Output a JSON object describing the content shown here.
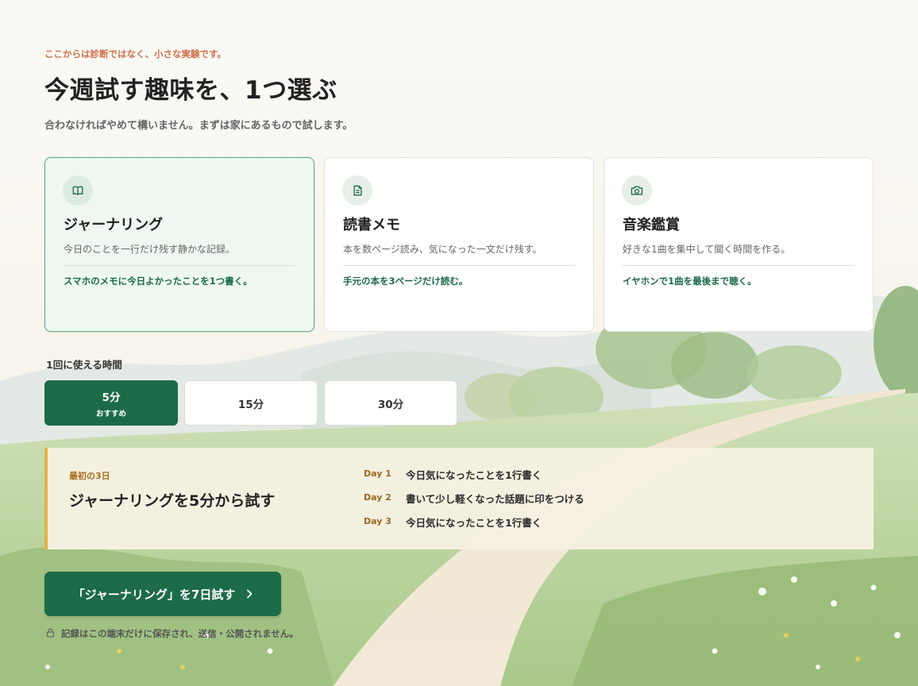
{
  "header": {
    "eyebrow": "ここからは診断ではなく、小さな実験です。",
    "title": "今週試す趣味を、1つ選ぶ",
    "subtitle": "合わなければやめて構いません。まずは家にあるもので試します。"
  },
  "hobbies": [
    {
      "icon": "book-icon",
      "title": "ジャーナリング",
      "description": "今日のことを一行だけ残す静かな記録。",
      "action": "スマホのメモに今日よかったことを1つ書く。",
      "selected": true
    },
    {
      "icon": "document-icon",
      "title": "読書メモ",
      "description": "本を数ページ読み、気になった一文だけ残す。",
      "action": "手元の本を3ページだけ読む。",
      "selected": false
    },
    {
      "icon": "camera-icon",
      "title": "音楽鑑賞",
      "description": "好きな1曲を集中して聞く時間を作る。",
      "action": "イヤホンで1曲を最後まで聴く。",
      "selected": false
    }
  ],
  "time": {
    "label": "1回に使える時間",
    "options": [
      {
        "label": "5分",
        "badge": "おすすめ",
        "active": true
      },
      {
        "label": "15分",
        "active": false
      },
      {
        "label": "30分",
        "active": false
      }
    ]
  },
  "plan": {
    "eyebrow": "最初の3日",
    "title": "ジャーナリングを5分から試す",
    "days": [
      {
        "label": "Day 1",
        "text": "今日気になったことを1行書く"
      },
      {
        "label": "Day 2",
        "text": "書いて少し軽くなった話題に印をつける"
      },
      {
        "label": "Day 3",
        "text": "今日気になったことを1行書く"
      }
    ]
  },
  "cta": {
    "label": "「ジャーナリング」を7日試す"
  },
  "privacy_note": "記録はこの端末だけに保存され、送信・公開されません。",
  "colors": {
    "primary_green": "#1d6b48",
    "accent_orange": "#d0704a",
    "plan_border": "#e0b24a"
  }
}
